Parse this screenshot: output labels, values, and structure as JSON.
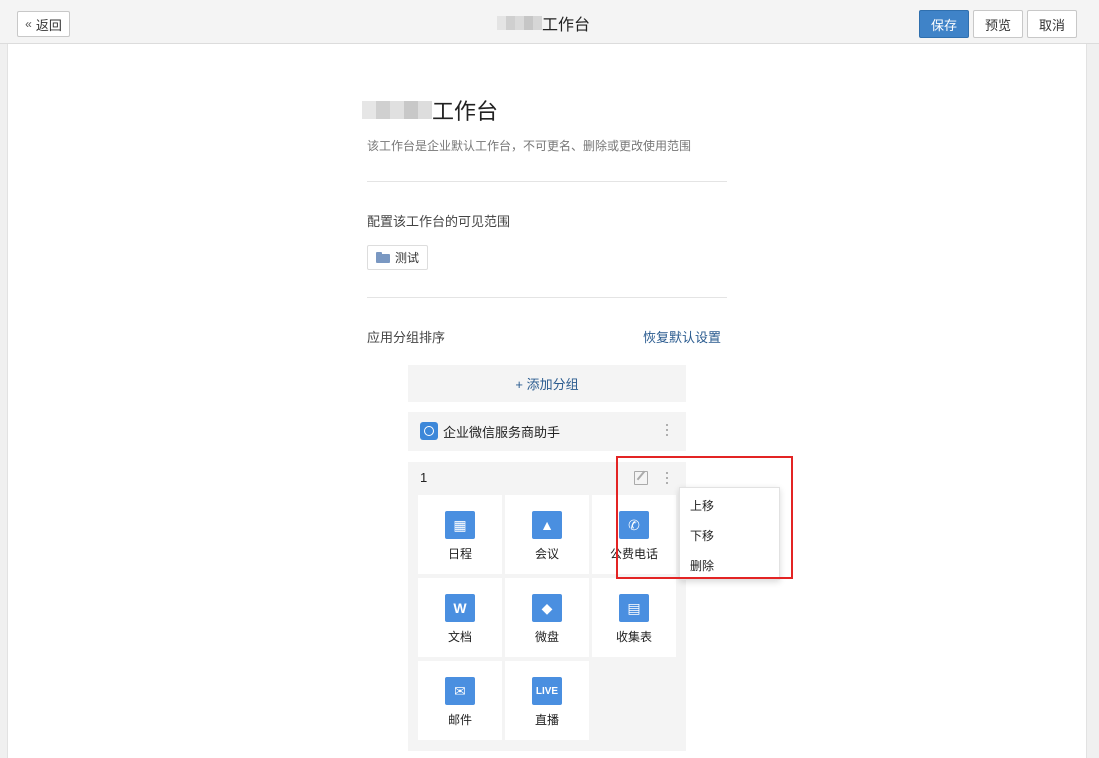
{
  "toolbar": {
    "back_label": "返回",
    "title_suffix": "工作台",
    "save_label": "保存",
    "preview_label": "预览",
    "cancel_label": "取消"
  },
  "workspace": {
    "title_suffix": "工作台",
    "description": "该工作台是企业默认工作台，不可更名、删除或更改使用范围"
  },
  "scope": {
    "label": "配置该工作台的可见范围",
    "tag": "测试"
  },
  "ordering": {
    "label": "应用分组排序",
    "restore_label": "恢复默认设置",
    "add_group_label": "+ 添加分组"
  },
  "groups": [
    {
      "name": "企业微信服务商助手"
    },
    {
      "name": "1",
      "apps": [
        {
          "name": "日程",
          "icon": "calendar-icon"
        },
        {
          "name": "会议",
          "icon": "meeting-icon"
        },
        {
          "name": "公费电话",
          "icon": "phone-icon"
        },
        {
          "name": "文档",
          "icon": "doc-icon",
          "glyph": "W"
        },
        {
          "name": "微盘",
          "icon": "drive-icon"
        },
        {
          "name": "收集表",
          "icon": "form-icon"
        },
        {
          "name": "邮件",
          "icon": "mail-icon"
        },
        {
          "name": "直播",
          "icon": "live-icon",
          "glyph": "LIVE"
        }
      ]
    }
  ],
  "context_menu": {
    "items": [
      "上移",
      "下移",
      "删除"
    ]
  },
  "colors": {
    "primary": "#3f83c8",
    "app_icon": "#4a8fe0",
    "link": "#2a5b8f",
    "highlight": "#e32424"
  }
}
